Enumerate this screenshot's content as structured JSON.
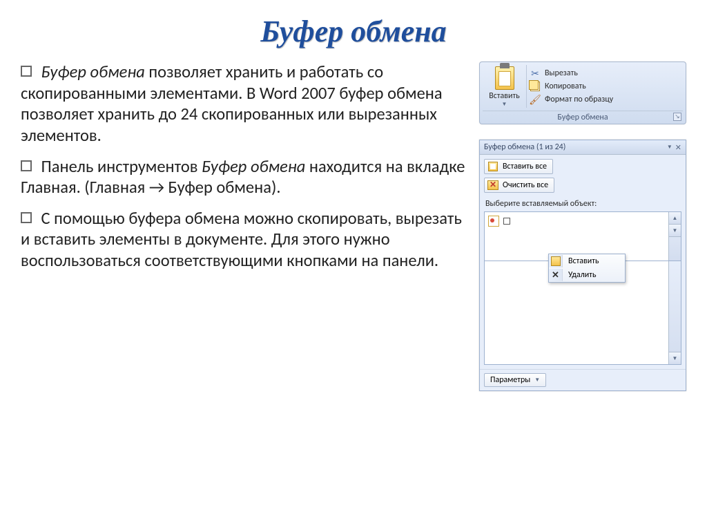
{
  "title": "Буфер обмена",
  "para1_prefix": "Буфер обмена",
  "para1_rest": " позволяет хранить и работать со скопированными элементами. В Word 2007 буфер обмена позволяет хранить до 24 скопированных или вырезанных элементов.",
  "para2_prefix": "Панель инструментов ",
  "para2_italic": "Буфер обмена",
  "para2_rest": " находится на вкладке Главная.  (Главная → Буфер обмена).",
  "para3": "С помощью буфера обмена можно скопировать, вырезать и вставить элементы в документе. Для этого нужно воспользоваться соответствующими кнопками на панели.",
  "ribbon": {
    "paste": "Вставить",
    "cut": "Вырезать",
    "copy": "Копировать",
    "format": "Формат по образцу",
    "group": "Буфер обмена"
  },
  "pane": {
    "title": "Буфер обмена (1 из 24)",
    "paste_all": "Вставить все",
    "clear_all": "Очистить все",
    "prompt": "Выберите вставляемый объект:",
    "ctx_paste": "Вставить",
    "ctx_delete": "Удалить",
    "params": "Параметры"
  }
}
